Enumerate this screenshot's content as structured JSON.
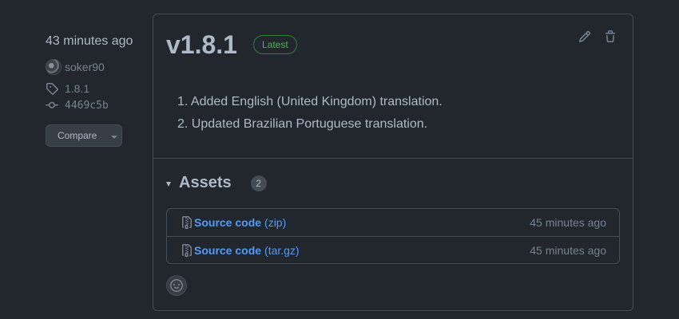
{
  "sidebar": {
    "time": "43 minutes ago",
    "author": "soker90",
    "tag": "1.8.1",
    "commit": "4469c5b",
    "compare_label": "Compare"
  },
  "release": {
    "version": "v1.8.1",
    "badge": "Latest",
    "notes": [
      "1. Added English (United Kingdom) translation.",
      "2. Updated Brazilian Portuguese translation."
    ]
  },
  "assets": {
    "title": "Assets",
    "count": "2",
    "items": [
      {
        "name": "Source code",
        "ext": "(zip)",
        "time": "45 minutes ago"
      },
      {
        "name": "Source code",
        "ext": "(tar.gz)",
        "time": "45 minutes ago"
      }
    ]
  },
  "icons": {
    "edit": "pencil-icon",
    "delete": "trash-icon",
    "tag": "tag-icon",
    "commit": "git-commit-icon",
    "file": "file-zip-icon",
    "reaction": "smiley-icon"
  },
  "colors": {
    "background": "#22272e",
    "border": "#444c56",
    "link": "#539bf5",
    "badge_green": "#57ab5a"
  }
}
